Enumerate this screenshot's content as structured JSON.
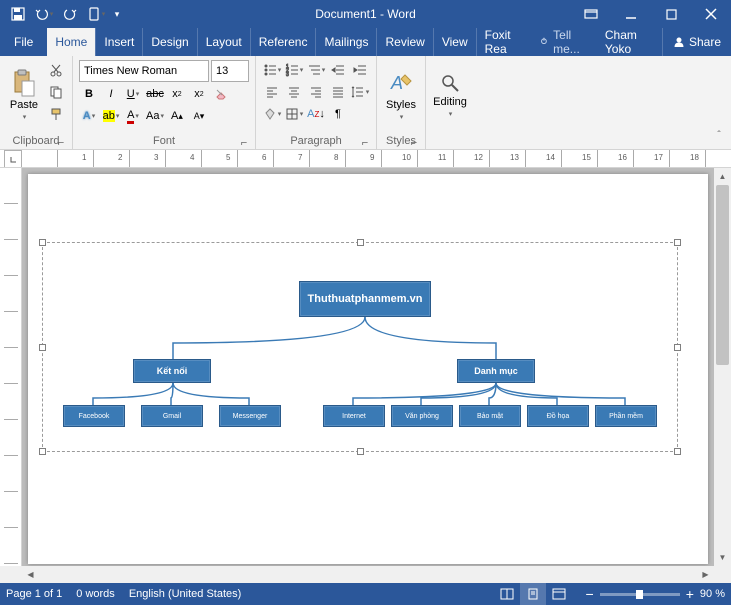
{
  "titlebar": {
    "title": "Document1 - Word"
  },
  "tabs": {
    "file": "File",
    "home": "Home",
    "insert": "Insert",
    "design": "Design",
    "layout": "Layout",
    "references": "Referenc",
    "mailings": "Mailings",
    "review": "Review",
    "view": "View",
    "foxit": "Foxit Rea",
    "tellme": "Tell me...",
    "user": "Cham Yoko",
    "share": "Share"
  },
  "ribbon": {
    "clipboard": {
      "label": "Clipboard",
      "paste": "Paste"
    },
    "font": {
      "label": "Font",
      "name": "Times New Roman",
      "size": "13"
    },
    "paragraph": {
      "label": "Paragraph"
    },
    "styles": {
      "label": "Styles",
      "btn": "Styles"
    },
    "editing": {
      "label": "",
      "btn": "Editing"
    }
  },
  "diagram": {
    "root": "Thuthuatphanmem.vn",
    "level2": {
      "a": "Kết nối",
      "b": "Danh mục"
    },
    "leaves": {
      "l1": "Facebook",
      "l2": "Gmail",
      "l3": "Messenger",
      "l4": "Internet",
      "l5": "Văn phòng",
      "l6": "Bảo mật",
      "l7": "Đồ họa",
      "l8": "Phần mềm"
    }
  },
  "statusbar": {
    "page": "Page 1 of 1",
    "words": "0 words",
    "lang": "English (United States)",
    "zoom": "90 %"
  }
}
